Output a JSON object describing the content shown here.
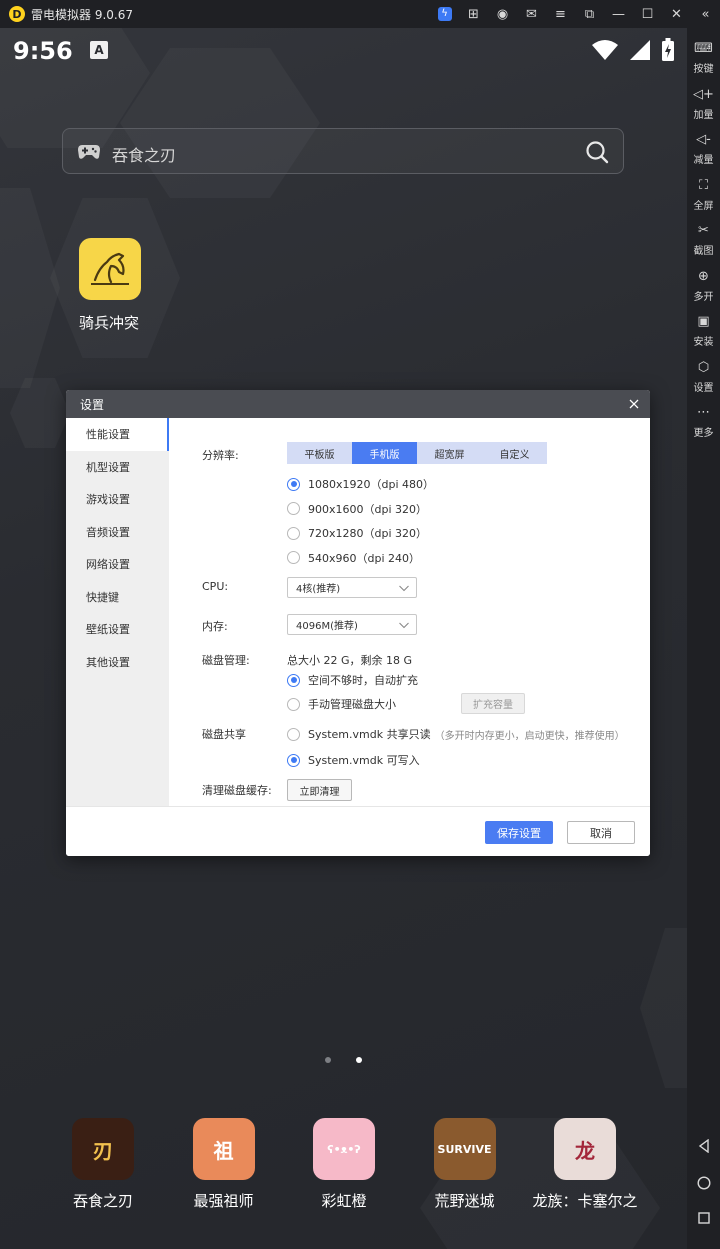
{
  "window": {
    "title": "雷电模拟器 9.0.67",
    "logo_letter": "D",
    "controls": [
      {
        "name": "toolbar-lightning-icon",
        "glyph": "ϟ",
        "accent": true
      },
      {
        "name": "gamepad-icon",
        "glyph": "⊞"
      },
      {
        "name": "account-icon",
        "glyph": "◉"
      },
      {
        "name": "mail-icon",
        "glyph": "✉"
      },
      {
        "name": "menu-icon",
        "glyph": "≡"
      },
      {
        "name": "restore-icon",
        "glyph": "⧉"
      },
      {
        "name": "minimize-icon",
        "glyph": "—"
      },
      {
        "name": "maximize-icon",
        "glyph": "☐"
      },
      {
        "name": "close-icon",
        "glyph": "✕"
      },
      {
        "name": "collapse-sidebar-icon",
        "glyph": "«"
      }
    ]
  },
  "status_bar": {
    "time": "9:56",
    "notification_letter": "A"
  },
  "search": {
    "text": "吞食之刃"
  },
  "home_app": {
    "label": "骑兵冲突"
  },
  "dock": [
    {
      "label": "吞食之刃",
      "glyph": "刃",
      "bg": "#3a1f14",
      "fg": "#f2c14e"
    },
    {
      "label": "最强祖师",
      "glyph": "祖",
      "bg": "#e98a5a",
      "fg": "#ffffff"
    },
    {
      "label": "彩虹橙",
      "glyph": "ʕ•ᴥ•ʔ",
      "bg": "#f6b9c8",
      "fg": "#ffffff"
    },
    {
      "label": "荒野迷城",
      "glyph": "SURVIVE",
      "bg": "#8a5a2e",
      "fg": "#ffffff"
    },
    {
      "label": "龙族：卡塞尔之",
      "glyph": "龙",
      "bg": "#e9dcd8",
      "fg": "#a3263a"
    }
  ],
  "sidebar": [
    {
      "name": "keys",
      "glyph": "⌨",
      "label": "按键"
    },
    {
      "name": "volume-up",
      "glyph": "◁+",
      "label": "加量"
    },
    {
      "name": "volume-down",
      "glyph": "◁-",
      "label": "减量"
    },
    {
      "name": "fullscreen",
      "glyph": "⛶",
      "label": "全屏"
    },
    {
      "name": "screenshot",
      "glyph": "✂",
      "label": "截图"
    },
    {
      "name": "multi",
      "glyph": "⊕",
      "label": "多开"
    },
    {
      "name": "install",
      "glyph": "▣",
      "label": "安装"
    },
    {
      "name": "settings",
      "glyph": "⬡",
      "label": "设置"
    },
    {
      "name": "more",
      "glyph": "⋯",
      "label": "更多"
    }
  ],
  "dialog": {
    "title": "设置",
    "nav": [
      "性能设置",
      "机型设置",
      "游戏设置",
      "音频设置",
      "网络设置",
      "快捷键",
      "壁纸设置",
      "其他设置"
    ],
    "active_nav": 0,
    "resolution": {
      "label": "分辨率:",
      "tabs": [
        "平板版",
        "手机版",
        "超宽屏",
        "自定义"
      ],
      "active_tab": 1,
      "options": [
        "1080x1920（dpi 480）",
        "900x1600（dpi 320）",
        "720x1280（dpi 320）",
        "540x960（dpi 240）"
      ],
      "selected": 0
    },
    "cpu": {
      "label": "CPU:",
      "value": "4核(推荐)"
    },
    "memory": {
      "label": "内存:",
      "value": "4096M(推荐)"
    },
    "disk": {
      "label": "磁盘管理:",
      "summary": "总大小 22 G，剩余 18 G",
      "auto_expand": "空间不够时，自动扩充",
      "manual": "手动管理磁盘大小",
      "expand_btn": "扩充容量"
    },
    "share": {
      "label": "磁盘共享",
      "readonly": "System.vmdk 共享只读",
      "readonly_hint": "（多开时内存更小，启动更快，推荐使用）",
      "writable": "System.vmdk 可写入"
    },
    "cache": {
      "label": "清理磁盘缓存:",
      "button": "立即清理"
    },
    "save": "保存设置",
    "cancel": "取消"
  }
}
